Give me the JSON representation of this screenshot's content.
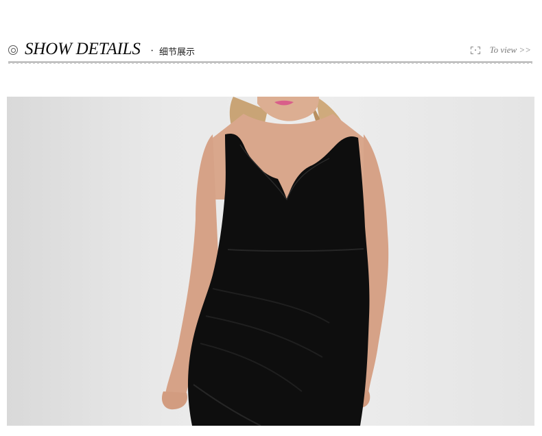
{
  "header": {
    "title": "SHOW DETAILS",
    "separator": "·",
    "subtitle": "细节展示",
    "view_link": "To view >>"
  },
  "icons": {
    "title_icon": "target-icon",
    "view_icon": "frame-icon"
  },
  "photo": {
    "subject": "model in black sleeveless sweetheart-neck bodycon dress",
    "colors": {
      "background": "#e6e6e6",
      "dress": "#0e0e0e",
      "skin": "#d9a78c",
      "hair": "#caa57a",
      "lips": "#d9608a"
    }
  }
}
